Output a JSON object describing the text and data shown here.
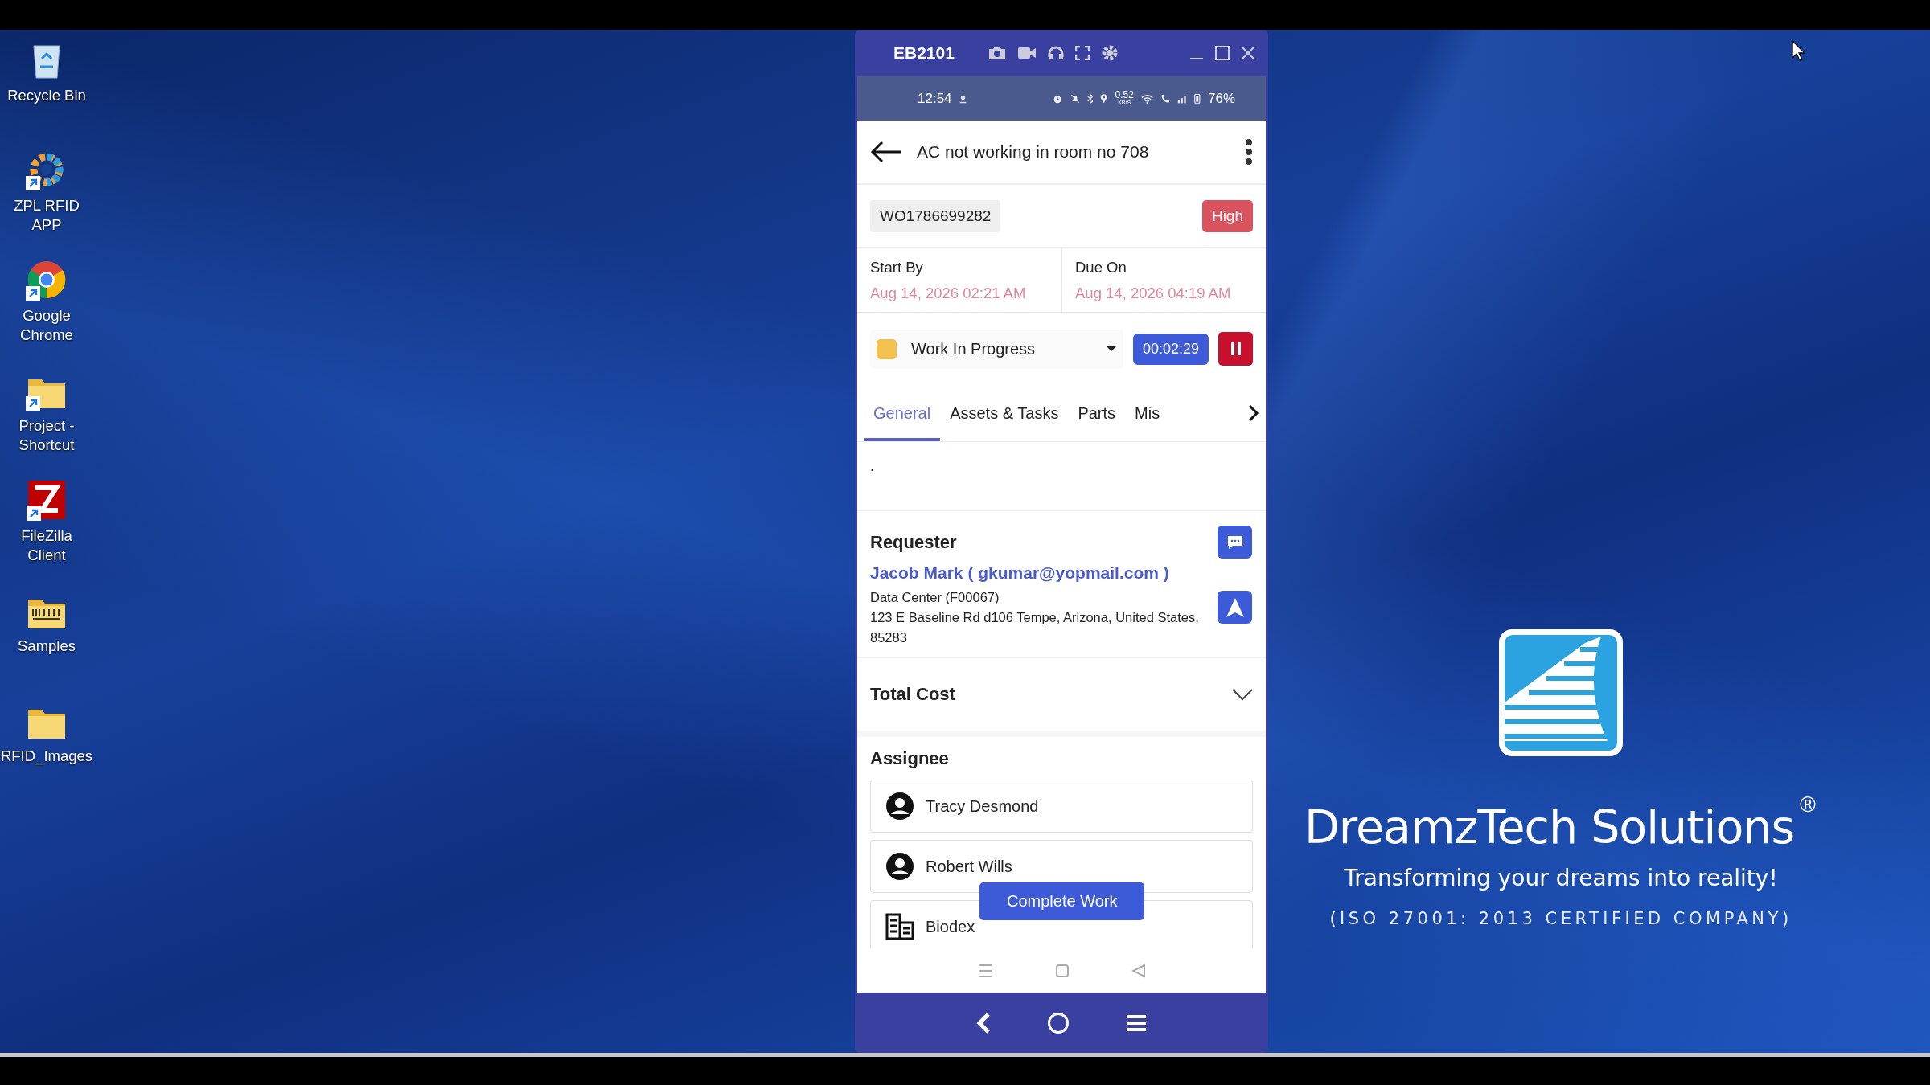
{
  "desktop_icons": [
    {
      "label": "Recycle Bin",
      "kind": "bin",
      "shortcut": false
    },
    {
      "label": "ZPL RFID APP",
      "kind": "gear",
      "shortcut": true
    },
    {
      "label": "Google Chrome",
      "kind": "chrome",
      "shortcut": true
    },
    {
      "label": "Project - Shortcut",
      "kind": "folder",
      "shortcut": true
    },
    {
      "label": "FileZilla Client",
      "kind": "filezilla",
      "shortcut": true
    },
    {
      "label": "Samples",
      "kind": "samples",
      "shortcut": false
    },
    {
      "label": "RFID_Images",
      "kind": "folder",
      "shortcut": false
    }
  ],
  "emulator": {
    "title": "EB2101",
    "status_bar": {
      "time": "12:54",
      "speed": "0.52",
      "speed_unit": "KB/S",
      "battery": "76%"
    }
  },
  "app": {
    "title": "AC not working in room no 708",
    "work_order": "WO1786699282",
    "priority": "High",
    "start_label": "Start By",
    "start_value": "Aug 14, 2026 02:21 AM",
    "due_label": "Due On",
    "due_value": "Aug 14, 2026 04:19 AM",
    "status": {
      "label": "Work In Progress",
      "color": "#f2c14e"
    },
    "timer": "00:02:29",
    "tabs": [
      {
        "label": "General",
        "selected": true
      },
      {
        "label": "Assets & Tasks",
        "selected": false
      },
      {
        "label": "Parts",
        "selected": false
      },
      {
        "label": "Mis",
        "selected": false
      }
    ],
    "description": ".",
    "requester": {
      "heading": "Requester",
      "contact": "Jacob Mark ( gkumar@yopmail.com )",
      "site": "Data Center (F00067)",
      "address": "123 E Baseline Rd d106 Tempe, Arizona, United States, 85283"
    },
    "total_cost": {
      "label": "Total Cost",
      "expanded": false
    },
    "assignee": {
      "heading": "Assignee",
      "items": [
        {
          "name": "Tracy Desmond",
          "kind": "person"
        },
        {
          "name": "Robert Wills",
          "kind": "person"
        },
        {
          "name": "Biodex",
          "kind": "company"
        }
      ]
    },
    "action_button": "Complete Work"
  },
  "brand": {
    "name": "DreamzTech Solutions",
    "mark": "®",
    "tagline": "Transforming your dreams into reality!",
    "certification": "(ISO 27001: 2013 CERTIFIED COMPANY)"
  }
}
